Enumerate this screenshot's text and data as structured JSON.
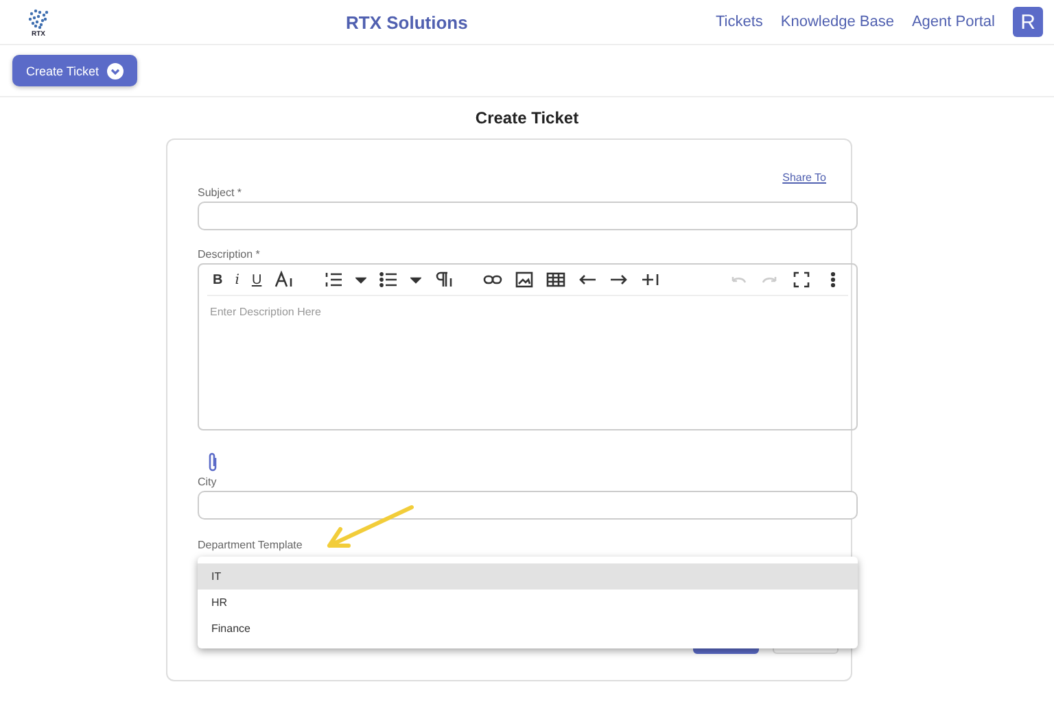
{
  "header": {
    "logo_text": "RTX",
    "brand": "RTX Solutions",
    "nav": [
      {
        "label": "Tickets"
      },
      {
        "label": "Knowledge Base"
      },
      {
        "label": "Agent Portal"
      }
    ],
    "avatar": "R"
  },
  "toolbar": {
    "button": "Create Ticket"
  },
  "page_title": "Create Ticket",
  "form": {
    "share_link": "Share To",
    "subject": {
      "label": "Subject *"
    },
    "description": {
      "label": "Description *",
      "placeholder": "Enter Description Here",
      "toolbar": [
        {
          "kind": "bold",
          "label": "B"
        },
        {
          "kind": "italic",
          "label": "i"
        },
        {
          "kind": "underline",
          "label": "U"
        },
        {
          "kind": "fontsize"
        },
        {
          "kind": "gap"
        },
        {
          "kind": "ol"
        },
        {
          "kind": "caret"
        },
        {
          "kind": "ul"
        },
        {
          "kind": "caret"
        },
        {
          "kind": "paragraph"
        },
        {
          "kind": "gap"
        },
        {
          "kind": "link"
        },
        {
          "kind": "image"
        },
        {
          "kind": "table"
        },
        {
          "kind": "left"
        },
        {
          "kind": "right"
        },
        {
          "kind": "insert"
        },
        {
          "kind": "fill"
        },
        {
          "kind": "undo",
          "disabled": true
        },
        {
          "kind": "redo",
          "disabled": true
        },
        {
          "kind": "fullscreen"
        },
        {
          "kind": "more"
        }
      ]
    },
    "city": {
      "label": "City"
    },
    "department": {
      "label": "Department Template",
      "options": [
        {
          "label": "IT",
          "selected": true
        },
        {
          "label": "HR",
          "selected": false
        },
        {
          "label": "Finance",
          "selected": false
        }
      ]
    }
  }
}
